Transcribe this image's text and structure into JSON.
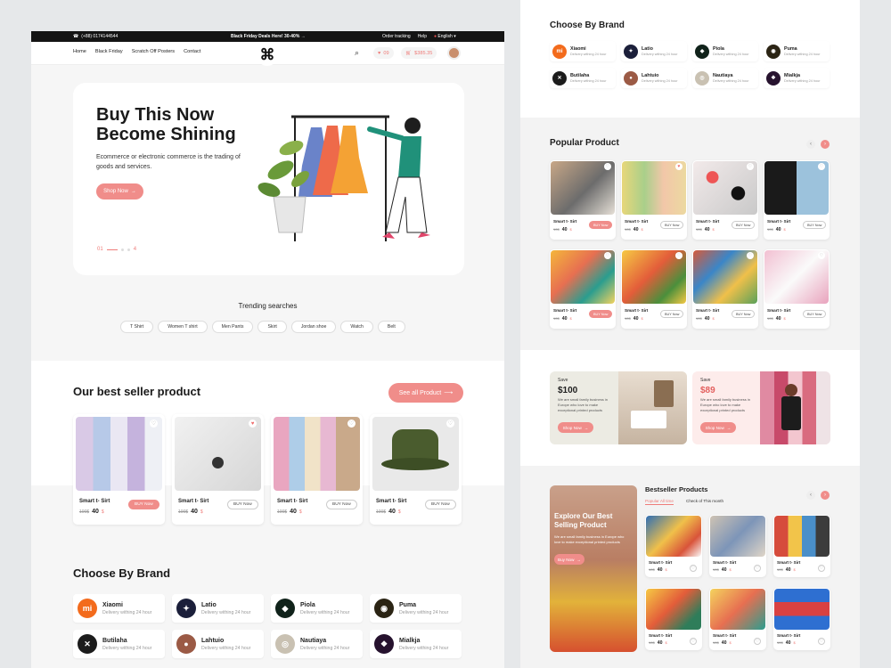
{
  "topbar": {
    "phone": "(+88) 0174144544",
    "promo": "Black Friday Deals Here! 30-40%",
    "tracking": "Order tracking",
    "help": "Help",
    "language": "English"
  },
  "nav": {
    "links": [
      "Home",
      "Black Friday",
      "Scratch Off Posters",
      "Contact"
    ],
    "logo_glyph": "⌘",
    "wishlist_count": "09",
    "cart_total": "$385.35"
  },
  "hero": {
    "title": "Buy This Now\nBecome Shining",
    "description": "Ecommerce or electronic commerce is the trading of goods and services.",
    "cta": "Shop Now",
    "slide_current": "01",
    "slide_total": "4"
  },
  "trending": {
    "title": "Trending searches",
    "items": [
      "T Shirt",
      "Women T shirt",
      "Men Pants",
      "Skirt",
      "Jordan shoe",
      "Watch",
      "Belt"
    ]
  },
  "best_seller": {
    "title": "Our best seller product",
    "see_all": "See all Product",
    "products": [
      {
        "name": "Smart t- Sirt",
        "old_price": "100$",
        "price": "40",
        "currency": "$",
        "button": "BUY Now"
      },
      {
        "name": "Smart t- Sirt",
        "old_price": "100$",
        "price": "40",
        "currency": "$",
        "button": "BUY Now"
      },
      {
        "name": "Smart t- Sirt",
        "old_price": "100$",
        "price": "40",
        "currency": "$",
        "button": "BUY Now"
      },
      {
        "name": "Smart t- Sirt",
        "old_price": "100$",
        "price": "40",
        "currency": "$",
        "button": "BUY Now"
      }
    ]
  },
  "brands": {
    "title": "Choose By Brand",
    "items": [
      {
        "name": "Xiaomi",
        "sub": "Delivery withing 24 hour",
        "color": "#f36b1c",
        "mark": "mi"
      },
      {
        "name": "Latio",
        "sub": "Delivery withing 24 hour",
        "color": "#1b1f3a",
        "mark": "✦"
      },
      {
        "name": "Piola",
        "sub": "Delivery withing 24 hour",
        "color": "#10221a",
        "mark": "◆"
      },
      {
        "name": "Puma",
        "sub": "Delivery withing 24 hour",
        "color": "#2b2414",
        "mark": "◉"
      },
      {
        "name": "Butilaha",
        "sub": "Delivery withing 24 hour",
        "color": "#1c1c1c",
        "mark": "✕"
      },
      {
        "name": "Lahtuio",
        "sub": "Delivery withing 24 hour",
        "color": "#9b5a45",
        "mark": "●"
      },
      {
        "name": "Nautiaya",
        "sub": "Delivery withing 24 hour",
        "color": "#c9c1b2",
        "mark": "◎"
      },
      {
        "name": "Mialkja",
        "sub": "Delivery withing 24 hour",
        "color": "#26122e",
        "mark": "❖"
      }
    ]
  },
  "popular": {
    "title": "Popular Product",
    "name": "Smart t- Sirt",
    "old_price": "10$",
    "price": "40",
    "currency": "$",
    "button": "BUY Now"
  },
  "promos": [
    {
      "save": "Save",
      "amount": "$100",
      "text": "We are small family business in Europe who love to make exceptional printed products",
      "cta": "Shop Now"
    },
    {
      "save": "Save",
      "amount": "$89",
      "text": "We are small family business in Europe who love to make exceptional printed products",
      "cta": "Shop Now"
    }
  ],
  "bestseller_side": {
    "title": "Bestseller Products",
    "tabs": [
      "Popular All time",
      "Check of This month"
    ],
    "banner_title": "Explore Our Best Selling Product",
    "banner_text": "We are small family business in Europe who love to make exceptional printed products",
    "banner_cta": "Buy Now",
    "name": "Smart t- Sirt",
    "old_price": "10$",
    "price": "40",
    "currency": "$"
  },
  "colors": {
    "accent": "#f08d8a",
    "dark": "#141414"
  }
}
